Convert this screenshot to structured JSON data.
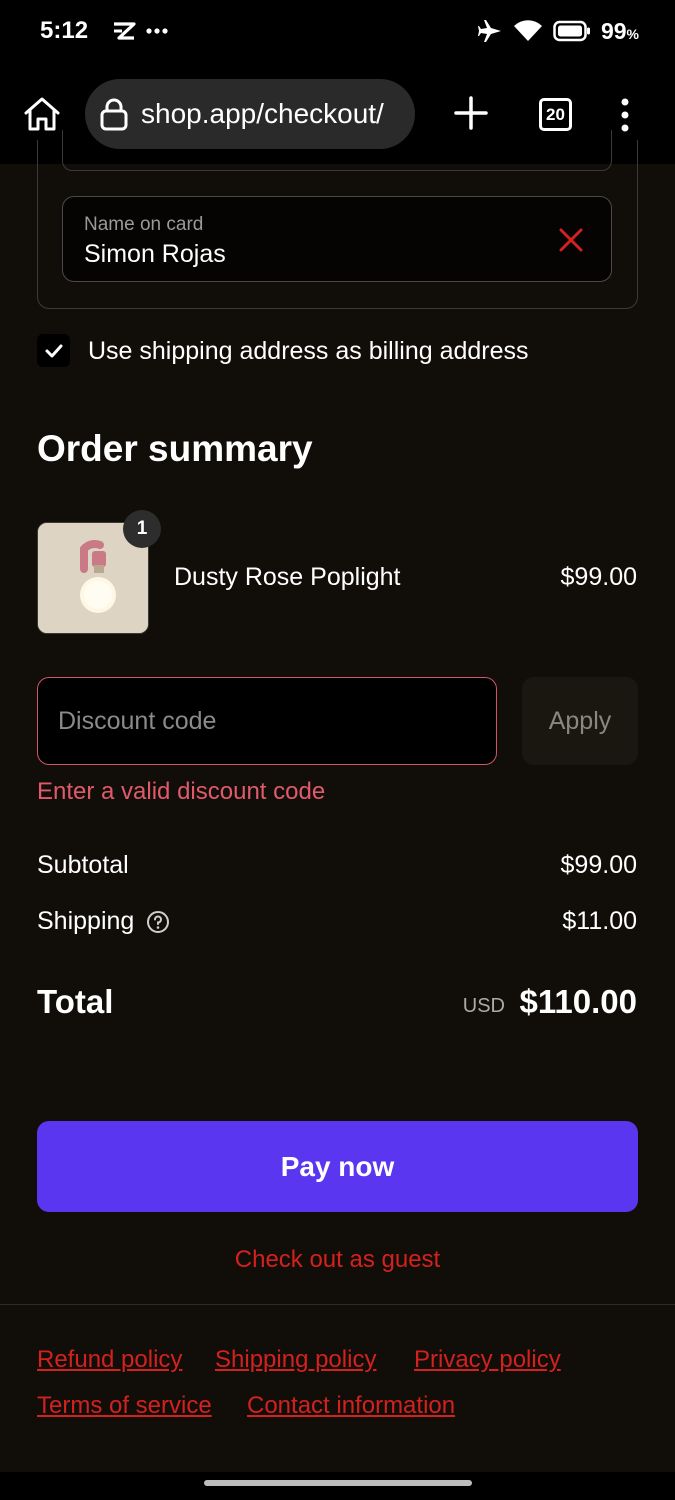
{
  "status_bar": {
    "time": "5:12",
    "battery_percent": "99",
    "battery_unit": "%",
    "icons": [
      "notification-icon",
      "more-dots-icon",
      "airplane-icon",
      "wifi-icon",
      "battery-icon"
    ]
  },
  "browser": {
    "url": "shop.app/checkout/",
    "tab_count": "20",
    "icons": [
      "home-icon",
      "lock-icon",
      "plus-icon",
      "tabs-icon",
      "menu-icon"
    ]
  },
  "payment": {
    "name_label": "Name on card",
    "name_value": "Simon Rojas",
    "billing_checkbox_checked": true,
    "billing_label": "Use shipping address as billing address"
  },
  "summary": {
    "title": "Order summary",
    "product": {
      "name": "Dusty Rose Poplight",
      "price": "$99.00",
      "quantity": "1"
    },
    "discount": {
      "placeholder": "Discount code",
      "apply_label": "Apply",
      "error": "Enter a valid discount code"
    },
    "subtotal_label": "Subtotal",
    "subtotal_value": "$99.00",
    "shipping_label": "Shipping",
    "shipping_value": "$11.00",
    "total_label": "Total",
    "total_currency": "USD",
    "total_value": "$110.00"
  },
  "actions": {
    "pay_label": "Pay now",
    "guest_label": "Check out as guest"
  },
  "footer": {
    "refund": "Refund policy",
    "shipping": "Shipping policy",
    "privacy": "Privacy policy",
    "terms": "Terms of service",
    "contact": "Contact information"
  },
  "colors": {
    "background": "#110e09",
    "accent": "#5b36f0",
    "link": "#d3211e",
    "error": "#e05a6c"
  }
}
